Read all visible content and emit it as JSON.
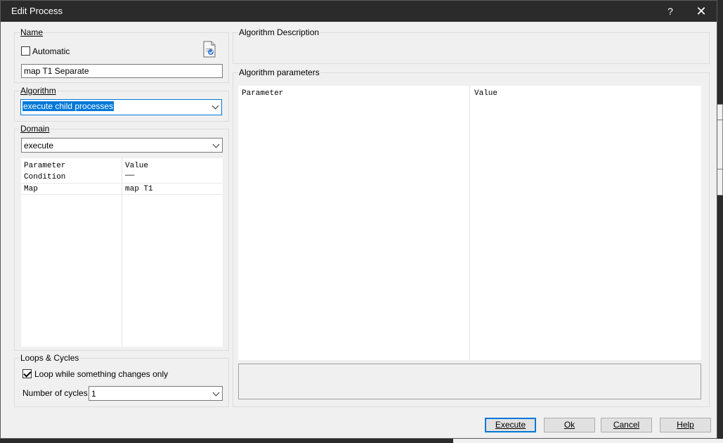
{
  "window": {
    "title": "Edit Process",
    "help_glyph": "?",
    "close_glyph": "✕"
  },
  "name_group": {
    "label": "Name",
    "automatic_label": "Automatic",
    "automatic_checked": false,
    "name_value": "map T1 Separate",
    "icon": "document-edit-icon"
  },
  "algorithm_group": {
    "label": "Algorithm",
    "selected": "execute child processes"
  },
  "domain_group": {
    "label": "Domain",
    "selected": "execute",
    "grid": {
      "columns": [
        "Parameter",
        "Value"
      ],
      "rows": [
        {
          "parameter": "Condition",
          "value": "——"
        },
        {
          "parameter": "Map",
          "value": "map T1"
        }
      ]
    }
  },
  "loops_group": {
    "label": "Loops & Cycles",
    "loop_label": "Loop while something changes only",
    "loop_checked": true,
    "cycles_label": "Number of cycles",
    "cycles_value": "1"
  },
  "description_group": {
    "label": "Algorithm Description",
    "text": ""
  },
  "parameters_group": {
    "label": "Algorithm parameters",
    "grid": {
      "columns": [
        "Parameter",
        "Value"
      ],
      "rows": []
    }
  },
  "buttons": {
    "execute": "Execute",
    "ok": "Ok",
    "cancel": "Cancel",
    "help": "Help"
  },
  "colors": {
    "titlebar": "#2b2b2b",
    "accent": "#0078d7",
    "dialog_bg": "#f0f0f0"
  }
}
